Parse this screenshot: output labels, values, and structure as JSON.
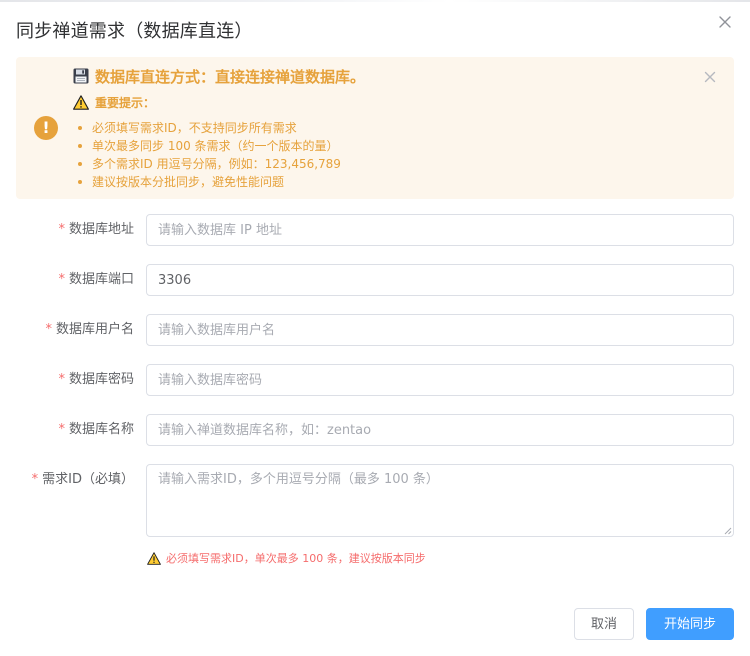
{
  "dialog": {
    "title": "同步禅道需求（数据库直连）"
  },
  "alert": {
    "title": "数据库直连方式：直接连接禅道数据库。",
    "subtitle": "重要提示：",
    "items": [
      "必须填写需求ID，不支持同步所有需求",
      "单次最多同步 100 条需求（约一个版本的量）",
      "多个需求ID 用逗号分隔，例如：123,456,789",
      "建议按版本分批同步，避免性能问题"
    ]
  },
  "form": {
    "db_host": {
      "label": "数据库地址",
      "value": "",
      "placeholder": "请输入数据库 IP 地址"
    },
    "db_port": {
      "label": "数据库端口",
      "value": "3306",
      "placeholder": ""
    },
    "db_user": {
      "label": "数据库用户名",
      "value": "",
      "placeholder": "请输入数据库用户名"
    },
    "db_password": {
      "label": "数据库密码",
      "value": "",
      "placeholder": "请输入数据库密码"
    },
    "db_name": {
      "label": "数据库名称",
      "value": "",
      "placeholder": "请输入禅道数据库名称，如：zentao"
    },
    "req_ids": {
      "label": "需求ID（必填）",
      "value": "",
      "placeholder": "请输入需求ID，多个用逗号分隔（最多 100 条）"
    },
    "required_mark": "*",
    "hint": "必须填写需求ID，单次最多 100 条，建议按版本同步"
  },
  "footer": {
    "cancel_label": "取消",
    "submit_label": "开始同步"
  },
  "colors": {
    "warning": "#e6a23c",
    "warning_bg": "#fdf6ec",
    "danger": "#f56c6c",
    "primary": "#409eff"
  },
  "icons": {
    "close": "close-icon",
    "alert": "exclamation-circle-icon",
    "floppy": "floppy-disk-icon",
    "warning": "warning-triangle-icon"
  }
}
